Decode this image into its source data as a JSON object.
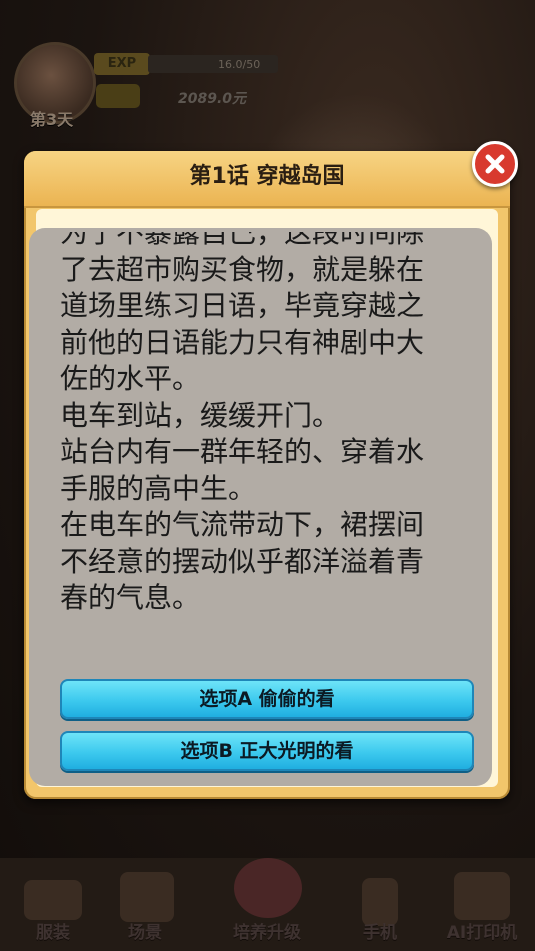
{
  "hud": {
    "day": "第3天",
    "exp_label": "EXP",
    "exp_value": "16.0/50",
    "money": "2089.0元"
  },
  "dialog": {
    "title": "第1话 穿越岛国",
    "story_lines": [
      "为了不暴露自己，这段时间除",
      "了去超市购买食物，就是躲在",
      "道场里练习日语，毕竟穿越之",
      "前他的日语能力只有神剧中大",
      "佐的水平。",
      "电车到站，缓缓开门。",
      "站台内有一群年轻的、穿着水",
      "手服的高中生。",
      "在电车的气流带动下，裙摆间",
      "不经意的摆动似乎都洋溢着青",
      "春的气息。"
    ],
    "options": [
      {
        "label": "选项A 偷偷的看"
      },
      {
        "label": "选项B 正大光明的看"
      }
    ],
    "close_icon": "close-icon"
  },
  "bottom_nav": {
    "items": [
      {
        "label": "服装",
        "icon": "clothing-icon"
      },
      {
        "label": "场景",
        "icon": "scene-icon"
      },
      {
        "label": "培养升级",
        "icon": "upgrade-icon"
      },
      {
        "label": "手机",
        "icon": "phone-icon"
      },
      {
        "label": "AI打印机",
        "icon": "printer-icon"
      }
    ]
  },
  "colors": {
    "dialog_frame": "#f2c66b",
    "text_panel": "#b2aca5",
    "option_button": "#3cc9ee",
    "close_button": "#d83a2e"
  }
}
